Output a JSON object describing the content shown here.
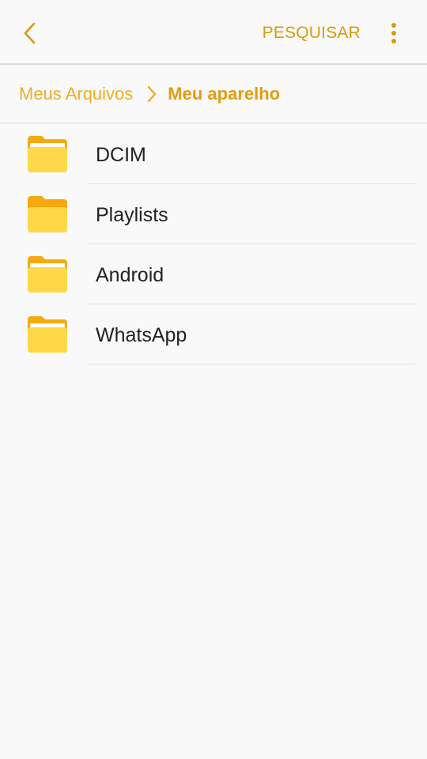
{
  "toolbar": {
    "back_icon": "chevron-left-icon",
    "search_label": "PESQUISAR",
    "more_icon": "more-vertical-icon"
  },
  "breadcrumb": {
    "root": "Meus Arquivos",
    "separator_icon": "chevron-right-icon",
    "current": "Meu aparelho"
  },
  "folders": [
    {
      "name": "DCIM",
      "icon": "folder-icon"
    },
    {
      "name": "Playlists",
      "icon": "folder-icon"
    },
    {
      "name": "Android",
      "icon": "folder-icon"
    },
    {
      "name": "WhatsApp",
      "icon": "folder-icon"
    }
  ],
  "colors": {
    "accent": "#d99b0c",
    "accent_light": "#efac2a",
    "folder_back": "#f7a90f",
    "folder_front": "#ffd84a",
    "background": "#f9f9f9"
  }
}
